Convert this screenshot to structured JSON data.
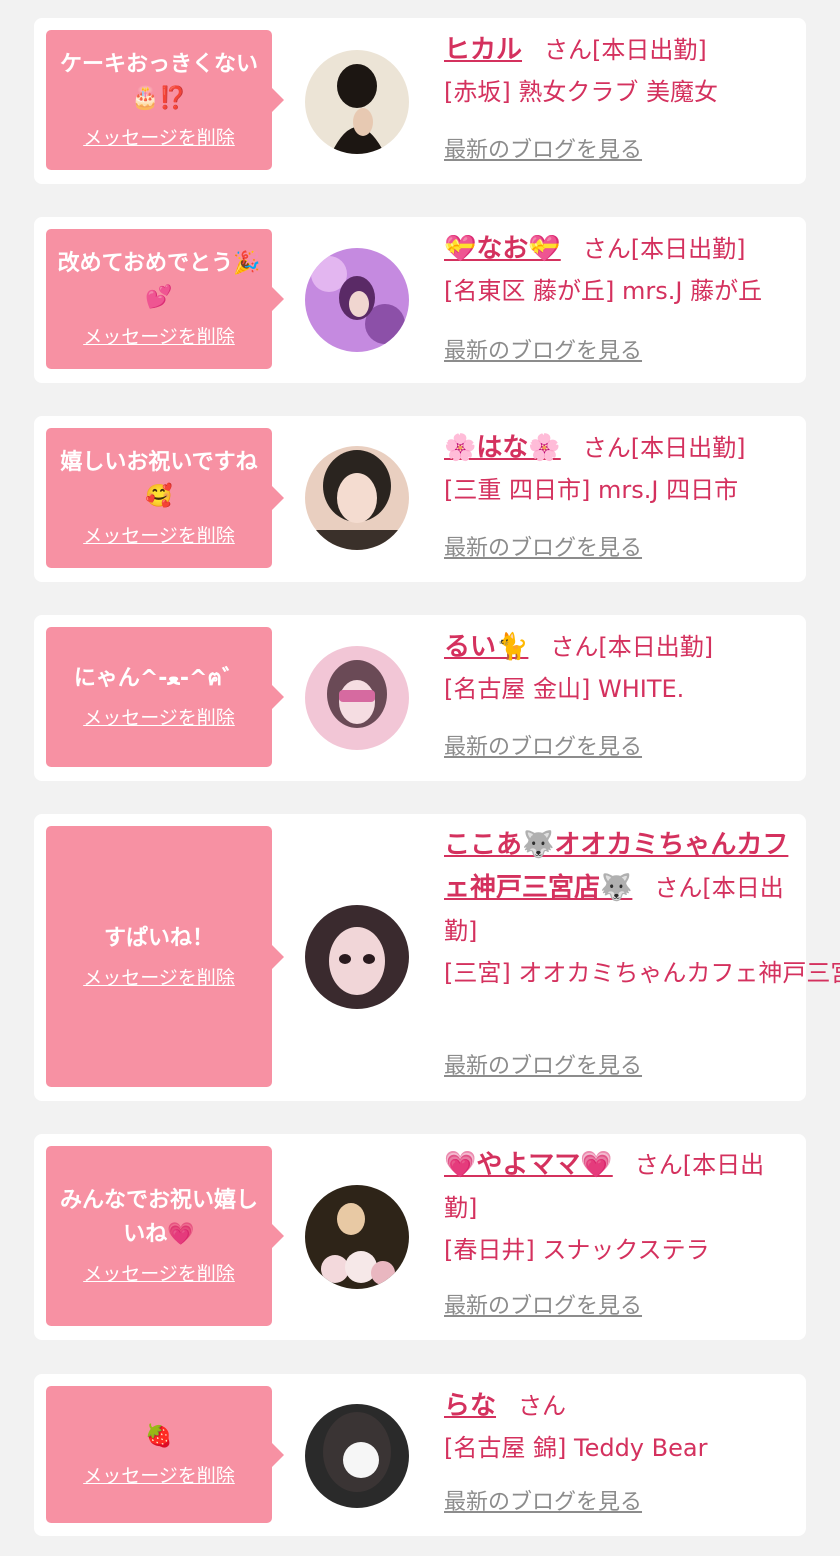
{
  "delete_label": "メッセージを削除",
  "blog_label": "最新のブログを見る",
  "san_label": "さん",
  "cards": [
    {
      "message": "ケーキおっきくない🎂⁉️",
      "name": "ヒカル",
      "status": "[本日出勤]",
      "shop": "[赤坂] 熟女クラブ 美魔女",
      "avatar": [
        "#ece4d6",
        "#1c1612"
      ]
    },
    {
      "message": "改めておめでとう🎉💕",
      "name": "💝なお💝",
      "status": "[本日出勤]",
      "shop": "[名東区 藤が丘] mrs.J 藤が丘",
      "avatar": [
        "#c58ae0",
        "#5a2a66"
      ]
    },
    {
      "message": "嬉しいお祝いですね🥰",
      "name": "🌸はな🌸",
      "status": "[本日出勤]",
      "shop": "[三重 四日市] mrs.J 四日市",
      "avatar": [
        "#e9cfc0",
        "#2a241f"
      ]
    },
    {
      "message": "にゃん^-ﻌ-^ฅ゛",
      "name": "るい🐈",
      "status": "[本日出勤]",
      "shop": "[名古屋 金山] WHITE.",
      "avatar": [
        "#f2c6d6",
        "#6a4a56"
      ]
    },
    {
      "message": "すぱいね！",
      "name": "ここあ🐺オオカミちゃんカフェ神戸三宮店🐺",
      "status": "[本日出勤]",
      "shop": "[三宮] オオカミちゃんカフェ神戸三宮店",
      "avatar": [
        "#f1d6d8",
        "#3a2a2e"
      ]
    },
    {
      "message": "みんなでお祝い嬉しいね💗",
      "name": "💗やよママ💗",
      "status": "[本日出勤]",
      "shop": "[春日井] スナックステラ",
      "avatar": [
        "#e8c9a4",
        "#2e2418"
      ]
    },
    {
      "message": "🍓",
      "name": "らな",
      "status": "",
      "shop": "[名古屋 錦] Teddy Bear",
      "avatar": [
        "#f6f6f6",
        "#2a2a2a"
      ]
    }
  ]
}
